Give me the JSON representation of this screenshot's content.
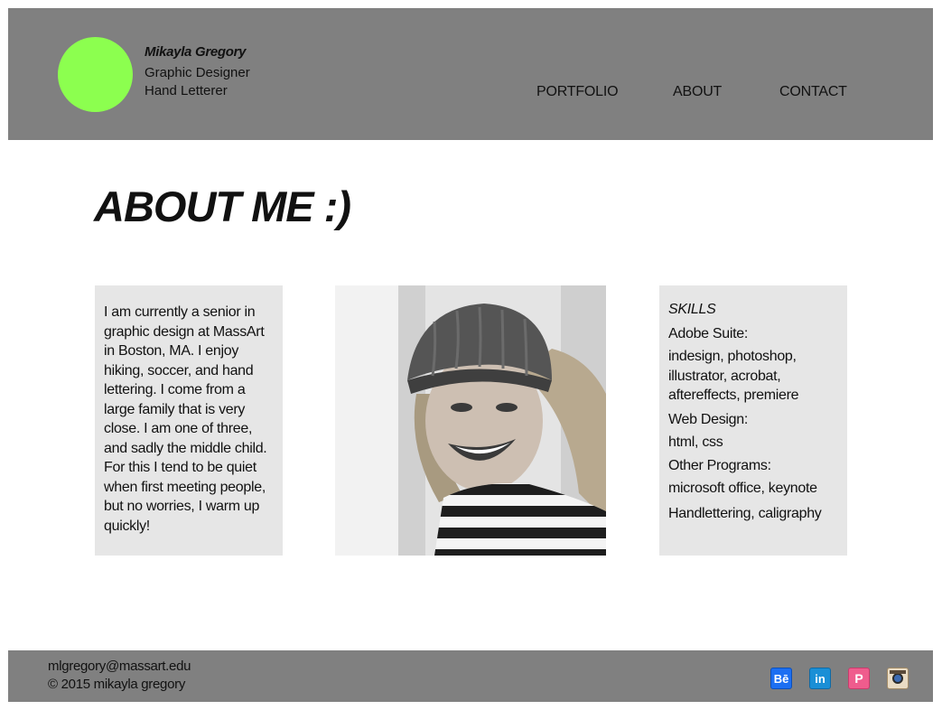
{
  "header": {
    "name": "Mikayla Gregory",
    "role1": "Graphic Designer",
    "role2": "Hand Letterer",
    "accent_color": "#8cff4f",
    "nav": [
      "PORTFOLIO",
      "ABOUT",
      "CONTACT"
    ]
  },
  "main": {
    "title": "ABOUT ME :)",
    "bio": "I am currently a senior in graphic design at MassArt in Boston, MA. I enjoy hiking, soccer, and hand lettering. I come from a large family that is very close. I am one of three, and sadly the middle child. For this I tend to be quiet when first meeting people, but no worries, I warm up quickly!",
    "skills": {
      "title": "SKILLS",
      "adobe_heading": "Adobe Suite:",
      "adobe_text": "indesign, photoshop, illustrator, acrobat, aftereffects, premiere",
      "web_heading": "Web Design:",
      "web_text": "html, css",
      "other_heading": "Other Programs:",
      "other_text": "microsoft office, keynote",
      "extra": "Handlettering, caligraphy"
    }
  },
  "footer": {
    "email": "mlgregory@massart.edu",
    "copyright": "© 2015 mikayla gregory",
    "social_icons": [
      "behance-icon",
      "linkedin-icon",
      "pinterest-icon",
      "instagram-icon"
    ],
    "behance_glyph": "Bē",
    "linkedin_glyph": "in",
    "pinterest_glyph": "P"
  }
}
